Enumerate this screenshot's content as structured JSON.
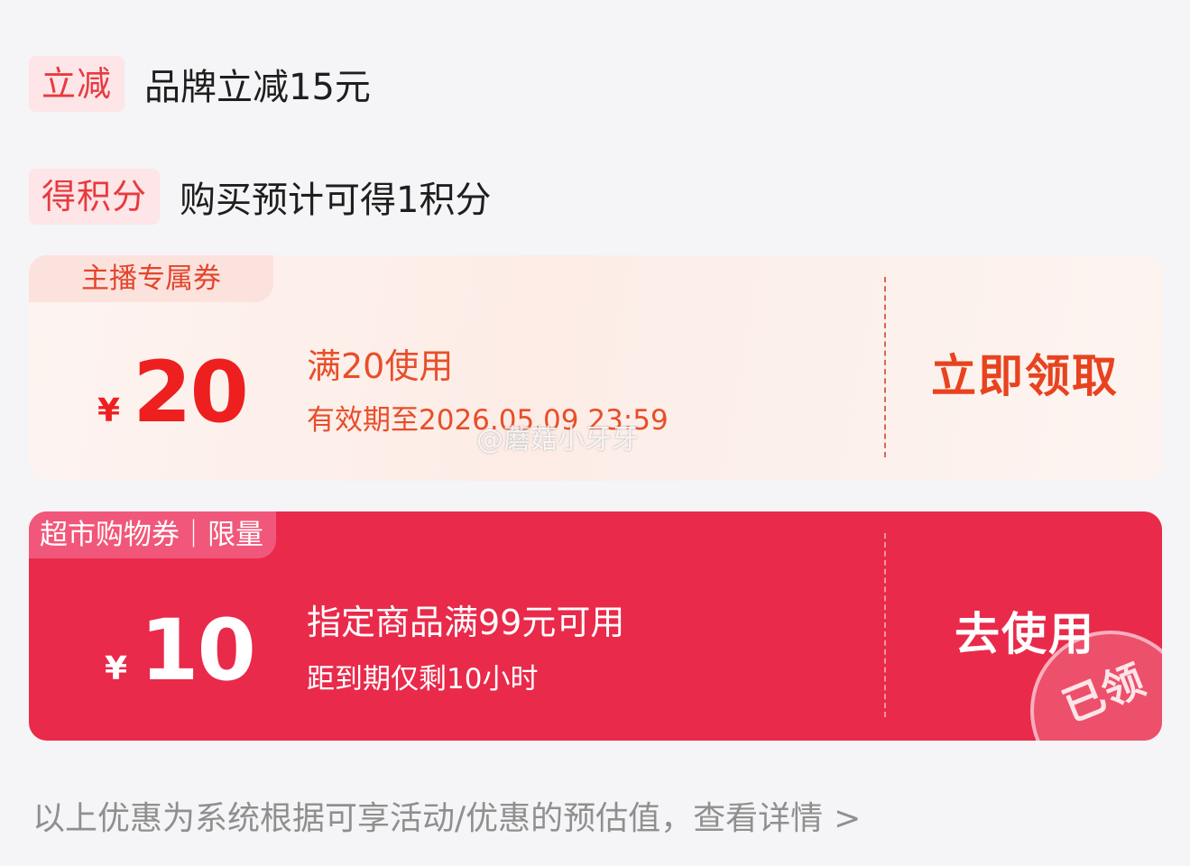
{
  "promotions": [
    {
      "tag": "立减",
      "text": "品牌立减15元"
    },
    {
      "tag": "得积分",
      "text": "购买预计可得1积分"
    }
  ],
  "coupon_anchor": {
    "label": "主播专属券",
    "currency": "¥",
    "amount": "20",
    "condition": "满20使用",
    "validity": "有效期至2026.05.09 23:59",
    "action": "立即领取"
  },
  "coupon_market": {
    "label": "超市购物券｜限量",
    "currency": "¥",
    "amount": "10",
    "condition": "指定商品满99元可用",
    "expiry": "距到期仅剩10小时",
    "action": "去使用",
    "stamp": "已领"
  },
  "watermark": "@蘑菇小牙牙",
  "footer": {
    "text": "以上优惠为系统根据可享活动/优惠的预估值，查看详情",
    "chevron": ">"
  },
  "colors": {
    "accent_red": "#e83a3f",
    "market_coupon_bg": "#e92a4b",
    "anchor_coupon_bg": "#fdf0ec"
  }
}
